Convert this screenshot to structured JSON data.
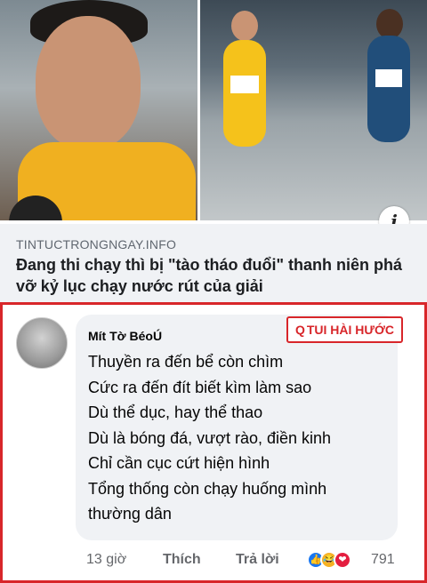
{
  "link_preview": {
    "domain": "TINTUCTRONGNGAY.INFO",
    "headline": "Đang thi chạy thì bị \"tào tháo đuổi\" thanh niên phá vỡ kỷ lục chạy nước rút của giải",
    "info_icon": "i",
    "photo_left_icon": "runner-closeup-photo",
    "photo_right_icon": "race-photo"
  },
  "comment": {
    "author": "Mít Tờ BéoÚ",
    "lines": [
      "Thuyền ra đến bể còn chìm",
      "Cức ra đến đít biết kìm làm sao",
      "Dù thể dục, hay thể thao",
      "Dù là bóng đá, vượt rào, điền kinh",
      "Chỉ cần cục cứt hiện hình",
      "Tổng thống còn chạy huống mình",
      "thường dân"
    ],
    "watermark": {
      "icon": "Q",
      "text": "TUI HÀI HƯỚC"
    },
    "time": "13 giờ",
    "like_label": "Thích",
    "reply_label": "Trả lời",
    "reaction_count": "791",
    "reactions": [
      "like",
      "haha",
      "love"
    ]
  },
  "colors": {
    "accent_red": "#d8262a",
    "facebook_blue": "#1877f2",
    "bubble": "#f0f2f5"
  }
}
